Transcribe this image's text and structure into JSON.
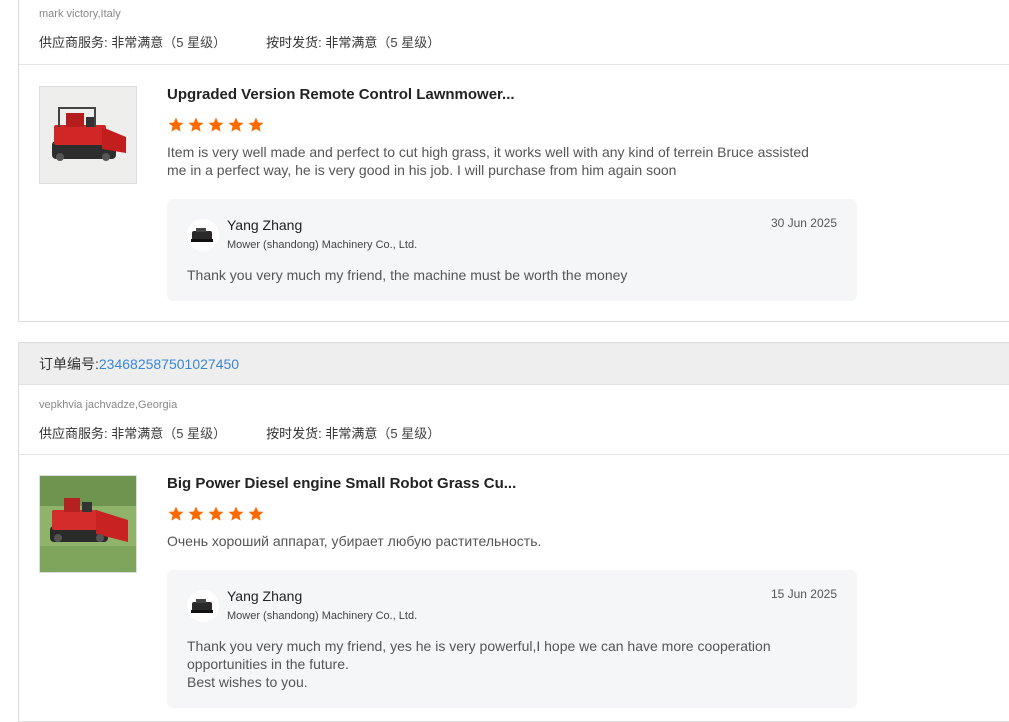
{
  "reviews": [
    {
      "buyer": "mark victory,Italy",
      "supplier_service_label": "供应商服务:",
      "supplier_service_value": "非常满意",
      "supplier_service_stars": "（5 星级）",
      "on_time_label": "按时发货:",
      "on_time_value": "非常满意",
      "on_time_stars": "（5 星级）",
      "product_title": "Upgraded Version Remote Control Lawnmower...",
      "rating": 5,
      "text": "Item is very well made and perfect to cut high grass, it works well with any kind of terrein Bruce assisted me in a perfect way, he is very good in his job.  I will purchase from him again soon",
      "reply": {
        "name": "Yang Zhang",
        "company": "Mower (shandong) Machinery Co., Ltd.",
        "date": "30 Jun 2025",
        "text": "Thank you very much my friend, the machine must be worth the money"
      }
    },
    {
      "order_label": "订单编号:",
      "order_number": "234682587501027450",
      "buyer": "vepkhvia jachvadze,Georgia",
      "supplier_service_label": "供应商服务:",
      "supplier_service_value": "非常满意",
      "supplier_service_stars": "（5 星级）",
      "on_time_label": "按时发货:",
      "on_time_value": "非常满意",
      "on_time_stars": "（5 星级）",
      "product_title": "Big Power Diesel engine Small Robot Grass Cu...",
      "rating": 5,
      "text": "Очень хороший аппарат, убирает любую растительность.",
      "reply": {
        "name": "Yang Zhang",
        "company": "Mower (shandong) Machinery Co., Ltd.",
        "date": "15 Jun 2025",
        "text": "Thank you very much my friend, yes he is very powerful,I hope we can have more cooperation opportunities in the future.\nBest wishes to you."
      }
    }
  ],
  "colors": {
    "star": "#ff6a00",
    "link": "#3a87d6",
    "reply_bg": "#f5f6f8"
  },
  "icons": [
    "star-icon",
    "avatar-logo-icon",
    "lawnmower-product-image"
  ]
}
